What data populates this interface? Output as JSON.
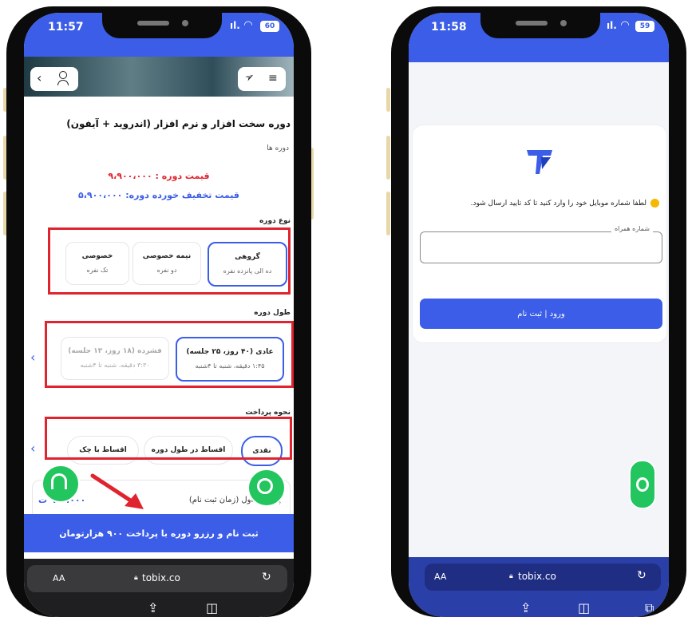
{
  "left_phone": {
    "status": {
      "time": "11:57",
      "battery": "60"
    },
    "course_title": "دوره سخت افزار و نرم افزار (اندروید + آیفون)",
    "breadcrumb": "دوره ها",
    "old_price": "قیمت دوره : ۹،۹۰۰،۰۰۰",
    "discount_price": "قیمت تخفیف خورده دوره: ۵،۹۰۰،۰۰۰",
    "course_type_label": "نوع دوره",
    "course_types": [
      {
        "title": "گروهی",
        "sub": "ده الی پانزده نفره"
      },
      {
        "title": "نیمه خصوصی",
        "sub": "دو نفره"
      },
      {
        "title": "خصوصی",
        "sub": "تک نفره"
      }
    ],
    "duration_label": "طول دوره",
    "durations": [
      {
        "title": "عادی (۴۰ روز، ۲۵ جلسه)",
        "sub": "۱:۴۵ دقیقه، شنبه تا ۴شنبه"
      },
      {
        "title": "فشرده (۱۸ روز، ۱۳ جلسه)",
        "sub": "۳:۳۰ دقیقه، شنبه تا ۴شنبه"
      }
    ],
    "payment_label": "نحوه پرداخت",
    "payments": [
      "نقدی",
      "اقساط در طول دوره",
      "اقساط با چک"
    ],
    "first_payment_label": "پرداخت اول (زمان ثبت نام)",
    "first_payment_amount": "۹۰۰،۰۰۰ ت",
    "cta": "ثبت نام و رزرو دوره با پرداخت ۹۰۰ هزارتومان",
    "url_aa": "AA",
    "url": "tobix.co"
  },
  "right_phone": {
    "status": {
      "time": "11:58",
      "battery": "59"
    },
    "instruction": "لطفا شماره موبایل خود را وارد کنید تا کد تایید ارسال شود.",
    "phone_label": "شماره همراه",
    "phone_value": "",
    "login_button": "ورود | ثبت نام",
    "url_aa": "AA",
    "url": "tobix.co"
  },
  "colors": {
    "accent": "#3b5de7",
    "highlight": "#e0242f",
    "whatsapp": "#22c55e",
    "price_red": "#e0242f"
  }
}
